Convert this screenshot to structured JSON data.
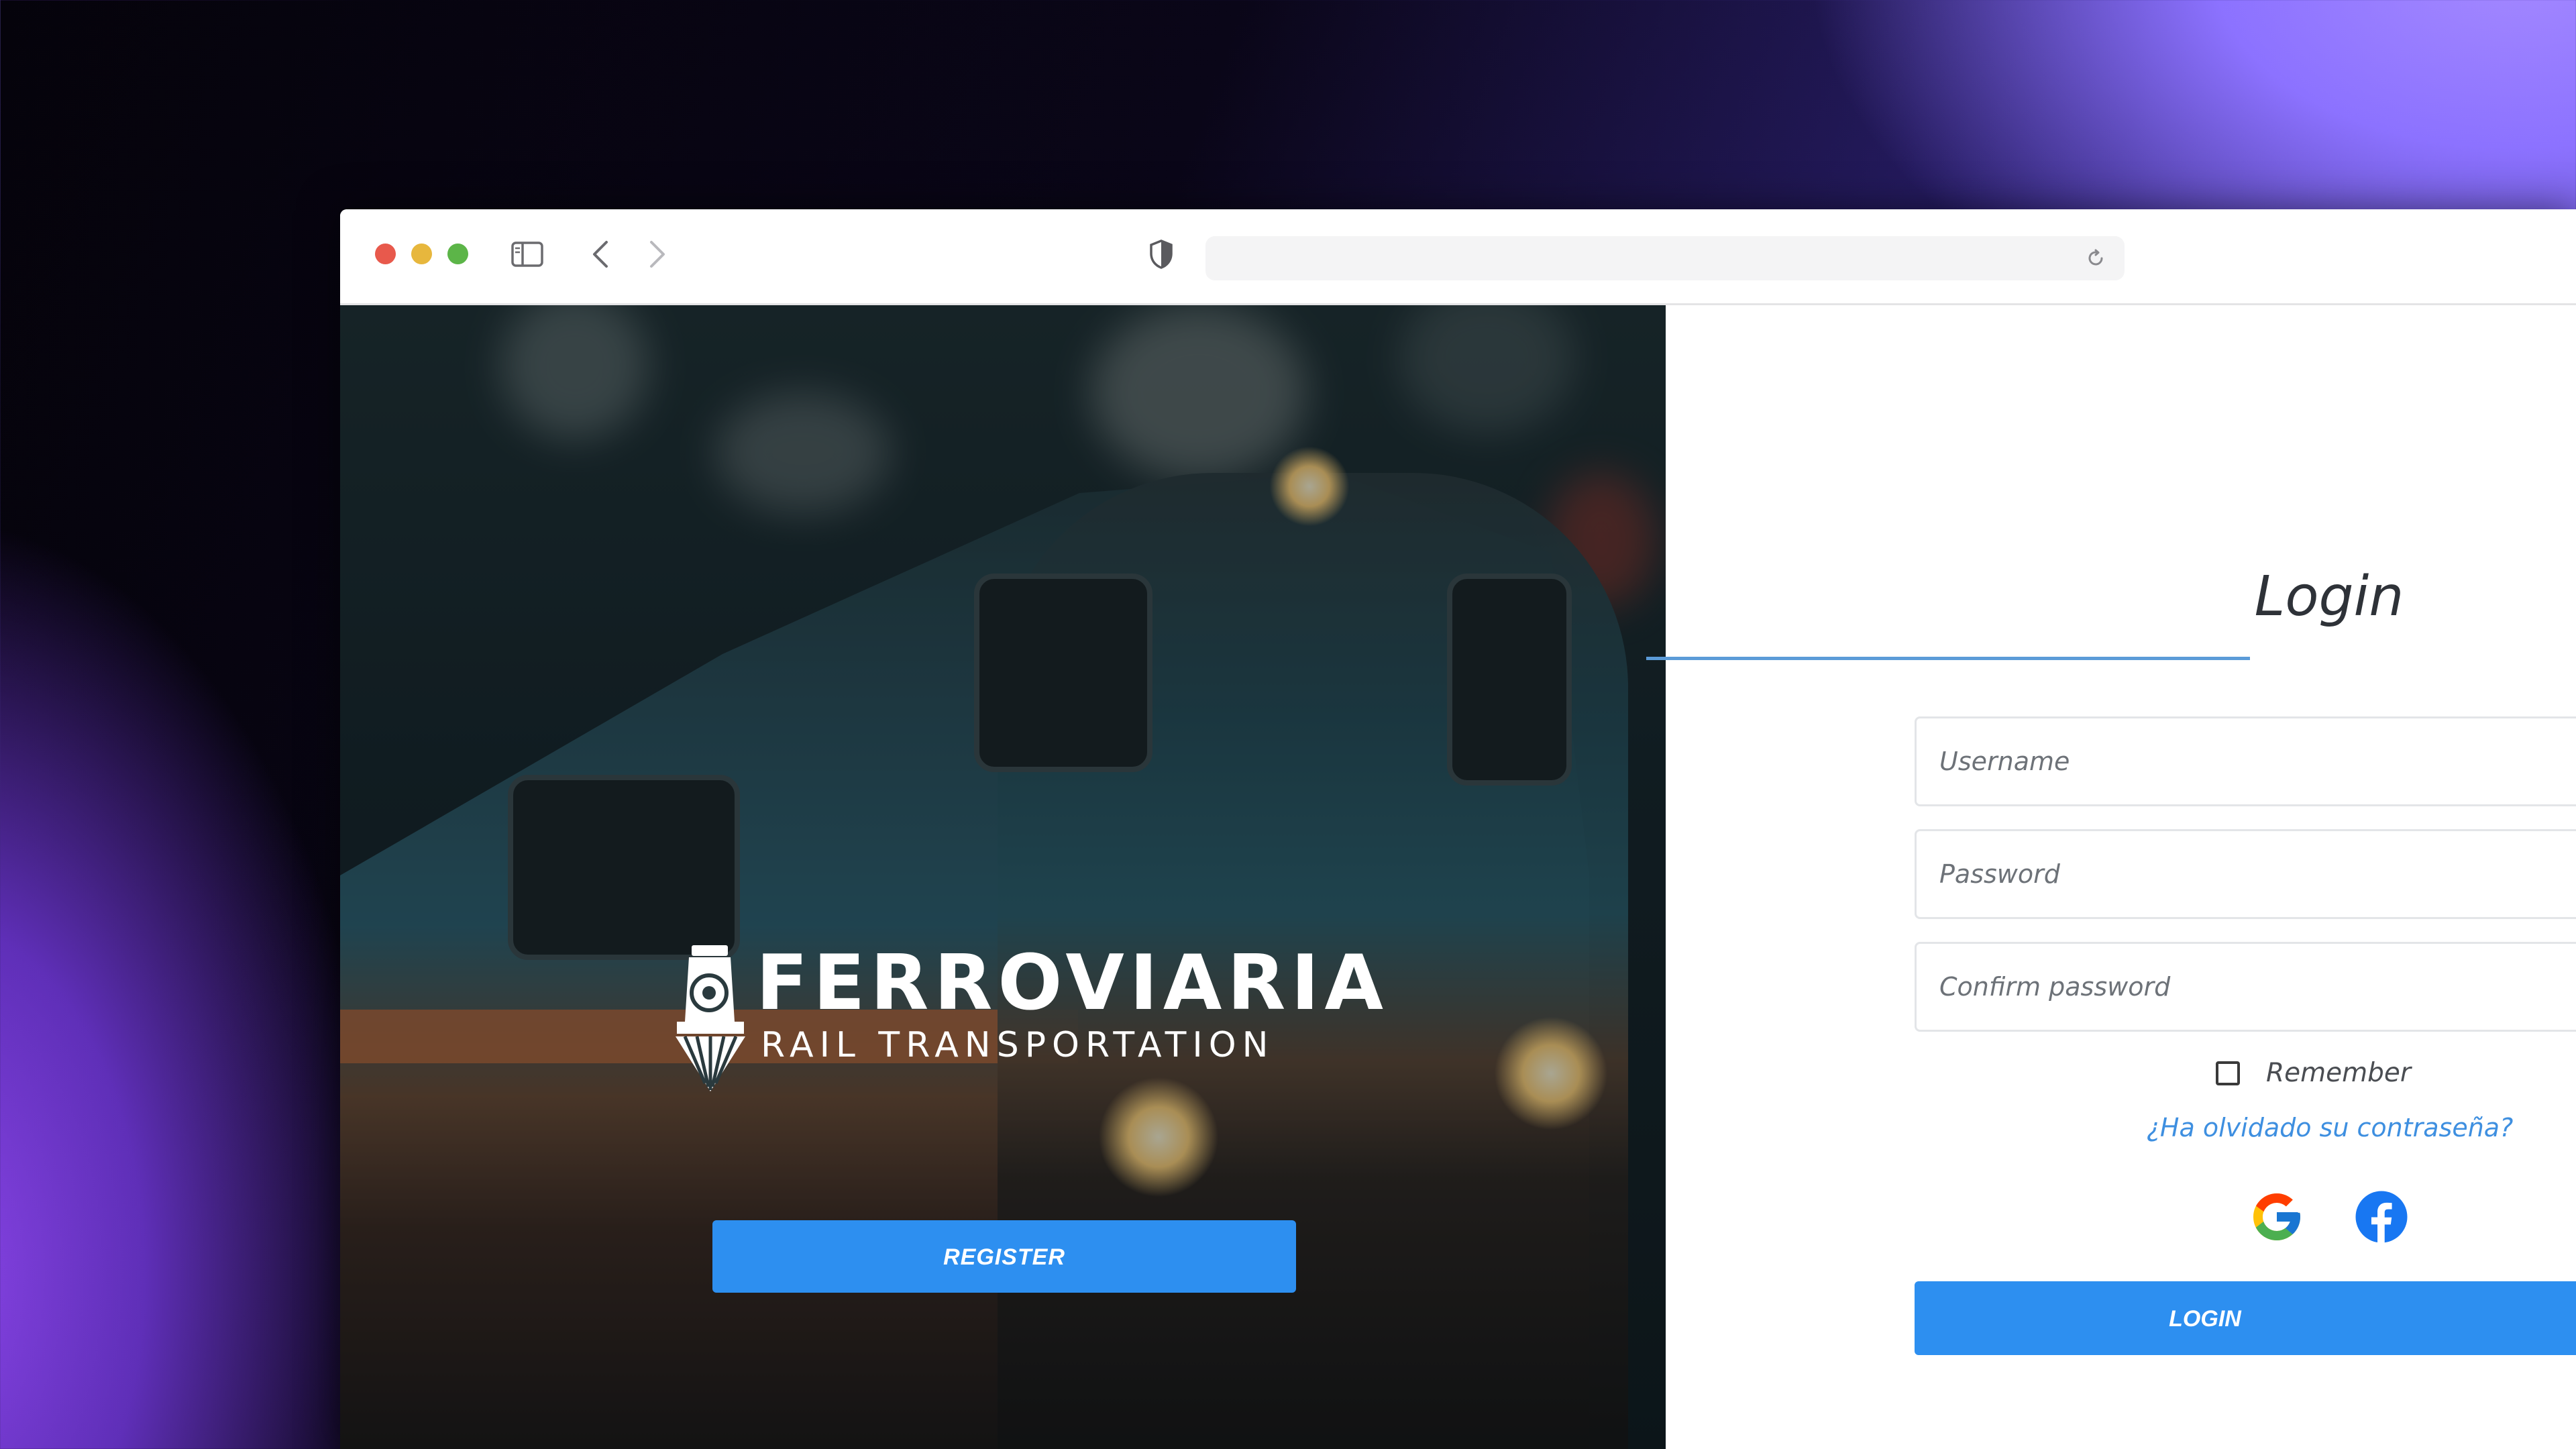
{
  "hero": {
    "brand_title": "FERROVIARIA",
    "brand_subtitle": "RAIL TRANSPORTATION",
    "register_label": "REGISTER"
  },
  "login": {
    "title": "Login",
    "username_placeholder": "Username",
    "password_placeholder": "Password",
    "confirm_placeholder": "Confirm password",
    "remember_label": "Remember",
    "forgot_link": "¿Ha olvidado su contraseña?",
    "login_label": "LOGIN",
    "social": [
      "google-icon",
      "facebook-icon"
    ]
  },
  "colors": {
    "primary_button": "#2d8ff0",
    "link": "#3e8fe0",
    "underline": "#5b9bd8"
  }
}
